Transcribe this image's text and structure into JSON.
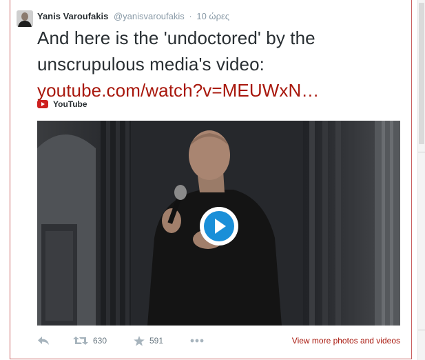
{
  "tweet": {
    "author_name": "Yanis Varoufakis",
    "author_handle": "@yanisvaroufakis",
    "separator": "·",
    "timestamp": "10 ώρες",
    "text": "And here is the 'undoctored' by the unscrupulous media's video:",
    "link_text": "youtube.com/watch?v=MEUWxN…",
    "card_source": "YouTube",
    "retweets": "630",
    "favorites": "591",
    "more_media_link": "View more photos and videos"
  },
  "colors": {
    "link": "#a8170c",
    "youtube_red": "#cd201f",
    "play_blue": "#1a8fd8",
    "meta_gray": "#8899a6"
  },
  "icons": [
    "reply-icon",
    "retweet-icon",
    "favorite-icon",
    "more-icon",
    "play-icon",
    "youtube-icon"
  ]
}
